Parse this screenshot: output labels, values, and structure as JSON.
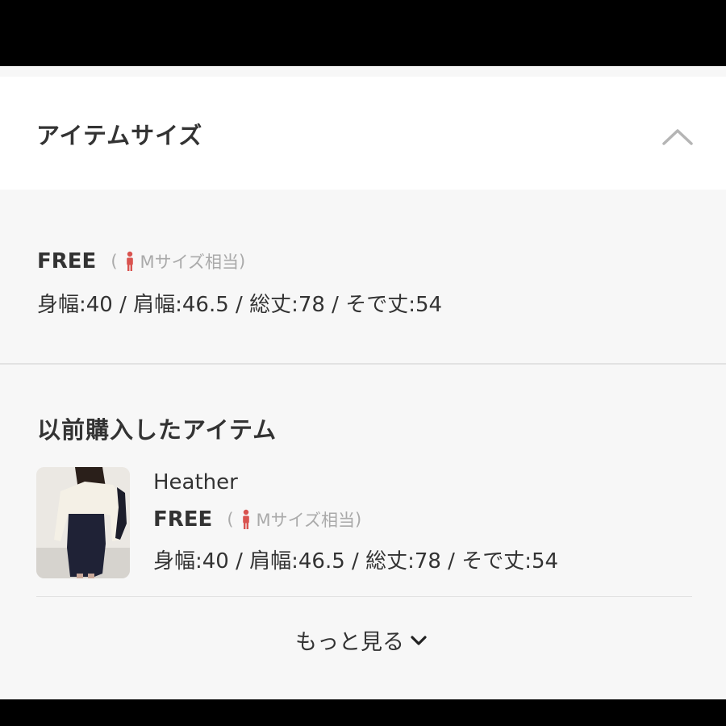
{
  "header": {
    "title": "アイテムサイズ"
  },
  "size_info": {
    "size_label": "FREE",
    "paren_open": "(",
    "size_equivalent": "Mサイズ相当",
    "paren_close": ")",
    "measurements": "身幅:40 / 肩幅:46.5 / 総丈:78 / そで丈:54"
  },
  "previous_items": {
    "title": "以前購入したアイテム",
    "items": [
      {
        "name": "Heather",
        "size_label": "FREE",
        "paren_open": "(",
        "size_equivalent": "Mサイズ相当",
        "paren_close": ")",
        "measurements": "身幅:40 / 肩幅:46.5 / 総丈:78 / そで丈:54"
      }
    ],
    "more_label": "もっと見る"
  },
  "colors": {
    "accent_person_icon": "#d9534f",
    "background": "#f7f7f7",
    "text": "#333333",
    "muted": "#aaaaaa"
  }
}
